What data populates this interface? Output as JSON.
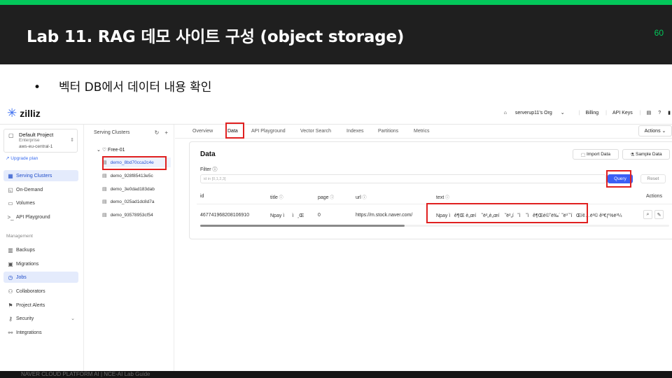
{
  "slide": {
    "title": "Lab 11. RAG 데모 사이트 구성 (object storage)",
    "page_number": "60",
    "bullet_text": "벡터 DB에서 데이터 내용 확인",
    "bullet_symbol": "•",
    "footer": "NAVER CLOUD PLATFORM AI  |  NCE-AI Lab Guide",
    "accent_color": "#03c75a",
    "highlight_color": "#e02020"
  },
  "app": {
    "brand": "zilliz",
    "topnav": {
      "org": "serverup11's Org",
      "billing": "Billing",
      "api_keys": "API Keys"
    },
    "sidebar": {
      "project_name": "Default Project",
      "project_tier": "Enterprise",
      "project_region": "aws-eu-central-1",
      "upgrade": "Upgrade plan",
      "items": [
        {
          "label": "Serving Clusters",
          "icon": "cluster-icon",
          "active": true
        },
        {
          "label": "On-Demand",
          "icon": "on-demand-icon"
        },
        {
          "label": "Volumes",
          "icon": "volume-icon"
        },
        {
          "label": "API Playground",
          "icon": "terminal-icon"
        }
      ],
      "management_label": "Management",
      "management_items": [
        {
          "label": "Backups",
          "icon": "backup-icon"
        },
        {
          "label": "Migrations",
          "icon": "migration-icon"
        },
        {
          "label": "Jobs",
          "icon": "jobs-icon",
          "active": true
        },
        {
          "label": "Collaborators",
          "icon": "users-icon"
        },
        {
          "label": "Project Alerts",
          "icon": "alert-icon"
        },
        {
          "label": "Security",
          "icon": "key-icon"
        },
        {
          "label": "Integrations",
          "icon": "integration-icon"
        }
      ]
    },
    "clusters": {
      "header": "Serving Clusters",
      "cluster": "Free-01",
      "collections": [
        "demo_8bd70cca2c4e",
        "demo_928f85413e5c",
        "demo_3e0dad183dab",
        "demo_025ad1dc8d7a",
        "demo_93578953cf54"
      ]
    },
    "tabs": [
      "Overview",
      "Data",
      "API Playground",
      "Vector Search",
      "Indexes",
      "Partitions",
      "Metrics"
    ],
    "active_tab": "Data",
    "actions_label": "Actions",
    "data_panel": {
      "title": "Data",
      "import_label": "Import Data",
      "sample_label": "Sample Data",
      "filter_label": "Filter",
      "filter_placeholder": "id in [0,1,2,3]",
      "query_label": "Query",
      "reset_label": "Reset",
      "columns": [
        "id",
        "title",
        "page",
        "url",
        "text",
        "Actions"
      ],
      "row": {
        "id": "467741968208106910",
        "title": "Npay ìì¸Œ",
        "page": "0",
        "url": "https://m.stock.naver.com/",
        "text": "Npay ìê¶Œ è„œí  ˜ë²„è„œí  ˜ë²„í˜ì  ˜ìê¶Œé©˜ë‰´ ˜ë³´˜íŒí¢…ë³© ê³€ƒ%ë³¼"
      }
    }
  }
}
